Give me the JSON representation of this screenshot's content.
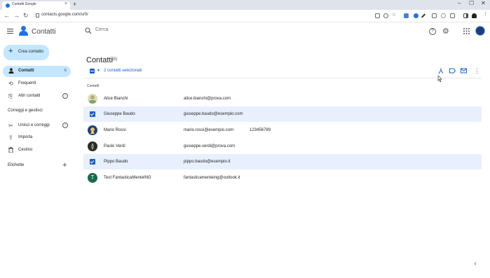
{
  "browser": {
    "tab_title": "Contatti Google",
    "url": "contacts.google.com/u/0/",
    "tab_close": "×",
    "new_tab": "+",
    "win_min": "–",
    "win_max": "☐",
    "win_close": "✕",
    "back": "←",
    "forward": "→",
    "reload": "↻"
  },
  "header": {
    "app_title": "Contatti",
    "search_placeholder": "Cerca",
    "help_icon": "?",
    "settings_icon": "⚙",
    "apps_icon": "⋮⋮"
  },
  "sidebar": {
    "create_label": "Crea contatto",
    "create_icon": "+",
    "items": [
      {
        "label": "Contatti",
        "count": "6",
        "icon": "person-icon",
        "glyph": "👤"
      },
      {
        "label": "Frequenti",
        "icon": "history-icon",
        "glyph": "⟲"
      },
      {
        "label": "Altri contatti",
        "icon": "person-add-icon",
        "glyph": "⎘",
        "info": "i"
      }
    ],
    "section_fix": "Correggi e gestisci",
    "fix_items": [
      {
        "label": "Unisci e correggi",
        "icon": "merge-icon",
        "glyph": "✂",
        "info": "i"
      },
      {
        "label": "Importa",
        "icon": "import-icon",
        "glyph": "⇪"
      },
      {
        "label": "Cestino",
        "icon": "trash-icon",
        "glyph": "🗑"
      }
    ],
    "section_labels": "Etichette",
    "labels_add": "+"
  },
  "main": {
    "title": "Contatti",
    "count": "(6)",
    "selection_text": "2 contatti selezionati",
    "selection_caret": "▼",
    "list_header": "Contatti",
    "more": "⋮",
    "collapse": "‹",
    "rows": [
      {
        "name": "Alice Bianchi",
        "email": "alice.bianchi@prova.com",
        "phone": "",
        "selected": false,
        "avatar": "photo-avatar"
      },
      {
        "name": "Giuseppe Baudo",
        "email": "giuseppe.baudo@esempio.com",
        "phone": "",
        "selected": true,
        "avatar": "checkbox"
      },
      {
        "name": "Mario Rossi",
        "email": "mario.rossi@esempio.com",
        "phone": "123456789",
        "selected": false,
        "avatar": "photo-avatar"
      },
      {
        "name": "Paolo Verdi",
        "email": "giuseppe.verdi@prova.com",
        "phone": "",
        "selected": false,
        "avatar": "photo-avatar"
      },
      {
        "name": "Pippo Baudo",
        "email": "pippo.baudo@esempio.it",
        "phone": "",
        "selected": true,
        "avatar": "checkbox"
      },
      {
        "name": "Test FantasticaMenteING",
        "email": "fantasticamenteing@outlook.it",
        "phone": "",
        "selected": false,
        "avatar": "T"
      }
    ]
  },
  "colors": {
    "accent": "#1a5fc8",
    "selected_row": "#e8f0fe",
    "nav_active": "#c2e7ff"
  }
}
